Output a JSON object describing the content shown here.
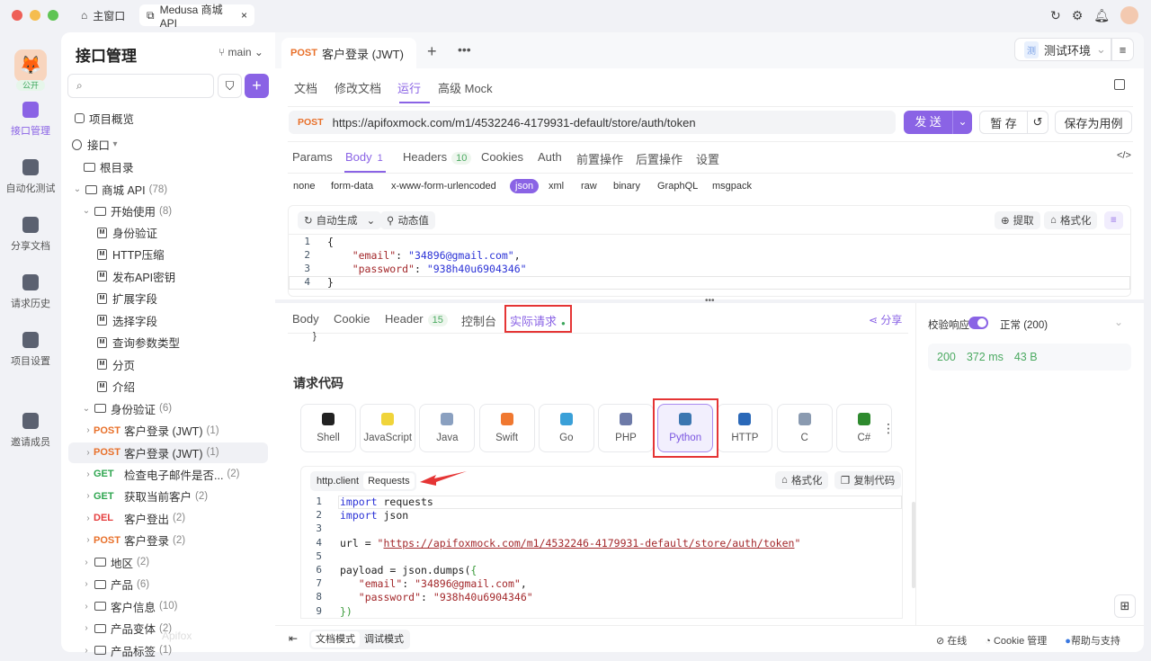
{
  "window": {
    "home_tab": "主窗口",
    "project_tab": "Medusa 商城 API"
  },
  "rail": {
    "visibility_badge": "公开",
    "items": [
      {
        "label": "接口管理",
        "active": true
      },
      {
        "label": "自动化测试"
      },
      {
        "label": "分享文档"
      },
      {
        "label": "请求历史"
      },
      {
        "label": "项目设置"
      },
      {
        "label": "邀请成员"
      }
    ]
  },
  "sidebar": {
    "title": "接口管理",
    "branch": "main",
    "search_placeholder": "",
    "watermark": "Apifox",
    "tree": [
      {
        "level": 0,
        "type": "overview",
        "label": "项目概览"
      },
      {
        "level": 0,
        "type": "section",
        "label": "接口",
        "chev": "▾"
      },
      {
        "level": 0,
        "type": "folder",
        "label": "根目录"
      },
      {
        "level": 1,
        "type": "folder",
        "label": "商城 API",
        "count": "(78)",
        "chev": "⌄"
      },
      {
        "level": 2,
        "type": "folder",
        "label": "开始使用",
        "count": "(8)",
        "chev": "⌄"
      },
      {
        "level": 3,
        "type": "doc",
        "label": "身份验证"
      },
      {
        "level": 3,
        "type": "doc",
        "label": "HTTP压缩"
      },
      {
        "level": 3,
        "type": "doc",
        "label": "发布API密钥"
      },
      {
        "level": 3,
        "type": "doc",
        "label": "扩展字段"
      },
      {
        "level": 3,
        "type": "doc",
        "label": "选择字段"
      },
      {
        "level": 3,
        "type": "doc",
        "label": "查询参数类型"
      },
      {
        "level": 3,
        "type": "doc",
        "label": "分页"
      },
      {
        "level": 3,
        "type": "doc",
        "label": "介绍"
      },
      {
        "level": 2,
        "type": "folder",
        "label": "身份验证",
        "count": "(6)",
        "chev": "⌄"
      },
      {
        "level": 3,
        "type": "api",
        "method": "POST",
        "label": "客户登录 (JWT)",
        "count": "(1)",
        "chev": "›"
      },
      {
        "level": 3,
        "type": "api",
        "method": "POST",
        "label": "客户登录 (JWT)",
        "count": "(1)",
        "chev": "›",
        "selected": true
      },
      {
        "level": 3,
        "type": "api",
        "method": "GET",
        "label": "检查电子邮件是否...",
        "count": "(2)",
        "chev": "›"
      },
      {
        "level": 3,
        "type": "api",
        "method": "GET",
        "label": "获取当前客户",
        "count": "(2)",
        "chev": "›"
      },
      {
        "level": 3,
        "type": "api",
        "method": "DEL",
        "label": "客户登出",
        "count": "(2)",
        "chev": "›"
      },
      {
        "level": 3,
        "type": "api",
        "method": "POST",
        "label": "客户登录",
        "count": "(2)",
        "chev": "›"
      },
      {
        "level": 2,
        "type": "folder",
        "label": "地区",
        "count": "(2)",
        "chev": "›"
      },
      {
        "level": 2,
        "type": "folder",
        "label": "产品",
        "count": "(6)",
        "chev": "›"
      },
      {
        "level": 2,
        "type": "folder",
        "label": "客户信息",
        "count": "(10)",
        "chev": "›"
      },
      {
        "level": 2,
        "type": "folder",
        "label": "产品变体",
        "count": "(2)",
        "chev": "›"
      },
      {
        "level": 2,
        "type": "folder",
        "label": "产品标签",
        "count": "(1)",
        "chev": "›"
      }
    ]
  },
  "editor_tab": {
    "method": "POST",
    "title": "客户登录 (JWT)"
  },
  "env": {
    "badge": "测",
    "name": "测试环境"
  },
  "subtabs": [
    "文档",
    "修改文档",
    "运行",
    "高级 Mock"
  ],
  "subtab_active": 2,
  "request": {
    "method": "POST",
    "url": "https://apifoxmock.com/m1/4532246-4179931-default/store/auth/token",
    "send": "发 送",
    "save_temp": "暂 存",
    "save_case": "保存为用例"
  },
  "param_tabs": [
    {
      "label": "Params"
    },
    {
      "label": "Body",
      "badge": "1",
      "active": true
    },
    {
      "label": "Headers",
      "badge": "10"
    },
    {
      "label": "Cookies"
    },
    {
      "label": "Auth"
    },
    {
      "label": "前置操作"
    },
    {
      "label": "后置操作"
    },
    {
      "label": "设置"
    }
  ],
  "body_types": [
    "none",
    "form-data",
    "x-www-form-urlencoded",
    "json",
    "xml",
    "raw",
    "binary",
    "GraphQL",
    "msgpack"
  ],
  "body_type_active": "json",
  "body_toolbar": {
    "auto_gen": "自动生成",
    "dynamic": "动态值",
    "extract": "提取",
    "format": "格式化"
  },
  "body_code": [
    [
      {
        "c": "pl",
        "t": "{"
      }
    ],
    [
      {
        "c": "pl",
        "t": "    "
      },
      {
        "c": "key",
        "t": "\"email\""
      },
      {
        "c": "pl",
        "t": ": "
      },
      {
        "c": "kw",
        "t": "\"34896@gmail.com\""
      },
      {
        "c": "pl",
        "t": ","
      }
    ],
    [
      {
        "c": "pl",
        "t": "    "
      },
      {
        "c": "key",
        "t": "\"password\""
      },
      {
        "c": "pl",
        "t": ": "
      },
      {
        "c": "kw",
        "t": "\"938h40u6904346\""
      }
    ],
    [
      {
        "c": "pl",
        "t": "}"
      }
    ]
  ],
  "resp_tabs": [
    {
      "label": "Body"
    },
    {
      "label": "Cookie"
    },
    {
      "label": "Header",
      "badge": "15"
    },
    {
      "label": "控制台"
    },
    {
      "label": "实际请求",
      "active": true
    }
  ],
  "share": "分享",
  "code_section": {
    "title": "请求代码",
    "residual": "}",
    "languages": [
      {
        "name": "Shell",
        "color": "#222"
      },
      {
        "name": "JavaScript",
        "color": "#f0d43a"
      },
      {
        "name": "Java",
        "color": "#8aa0c0"
      },
      {
        "name": "Swift",
        "color": "#f07830"
      },
      {
        "name": "Go",
        "color": "#3aa0d8"
      },
      {
        "name": "PHP",
        "color": "#6d7aa8"
      },
      {
        "name": "Python",
        "color": "#3b76b0",
        "active": true
      },
      {
        "name": "HTTP",
        "color": "#2a68b8"
      },
      {
        "name": "C",
        "color": "#8a9ab0"
      },
      {
        "name": "C#",
        "color": "#2e8a2e"
      }
    ],
    "libs": [
      "http.client",
      "Requests"
    ],
    "lib_active": "Requests",
    "format": "格式化",
    "copy": "复制代码"
  },
  "python_code": [
    [
      {
        "c": "kw",
        "t": "import"
      },
      {
        "c": "pl",
        "t": " requests"
      }
    ],
    [
      {
        "c": "kw",
        "t": "import"
      },
      {
        "c": "pl",
        "t": " json"
      }
    ],
    [],
    [
      {
        "c": "pl",
        "t": "url = "
      },
      {
        "c": "str",
        "t": "\""
      },
      {
        "c": "url",
        "t": "https://apifoxmock.com/m1/4532246-4179931-default/store/auth/token"
      },
      {
        "c": "str",
        "t": "\""
      }
    ],
    [],
    [
      {
        "c": "pl",
        "t": "payload = json.dumps("
      },
      {
        "c": "br",
        "t": "{"
      }
    ],
    [
      {
        "c": "pl",
        "t": "   "
      },
      {
        "c": "str",
        "t": "\"email\""
      },
      {
        "c": "pl",
        "t": ": "
      },
      {
        "c": "str",
        "t": "\"34896@gmail.com\""
      },
      {
        "c": "pl",
        "t": ","
      }
    ],
    [
      {
        "c": "pl",
        "t": "   "
      },
      {
        "c": "str",
        "t": "\"password\""
      },
      {
        "c": "pl",
        "t": ": "
      },
      {
        "c": "str",
        "t": "\"938h40u6904346\""
      }
    ],
    [
      {
        "c": "br",
        "t": "})"
      }
    ]
  ],
  "response": {
    "validate_label": "校验响应",
    "validate_on": true,
    "status_select": "正常 (200)",
    "status": "200",
    "time": "372 ms",
    "size": "43 B"
  },
  "footer": {
    "modes": [
      "文档模式",
      "调试模式"
    ],
    "mode_active": "文档模式",
    "online": "在线",
    "cookie": "Cookie 管理",
    "help": "帮助与支持"
  },
  "colors": {
    "accent": "#8a63e5",
    "post": "#e8702a",
    "get": "#2ea54f",
    "del": "#e53e3e",
    "highlight": "#e53535"
  }
}
